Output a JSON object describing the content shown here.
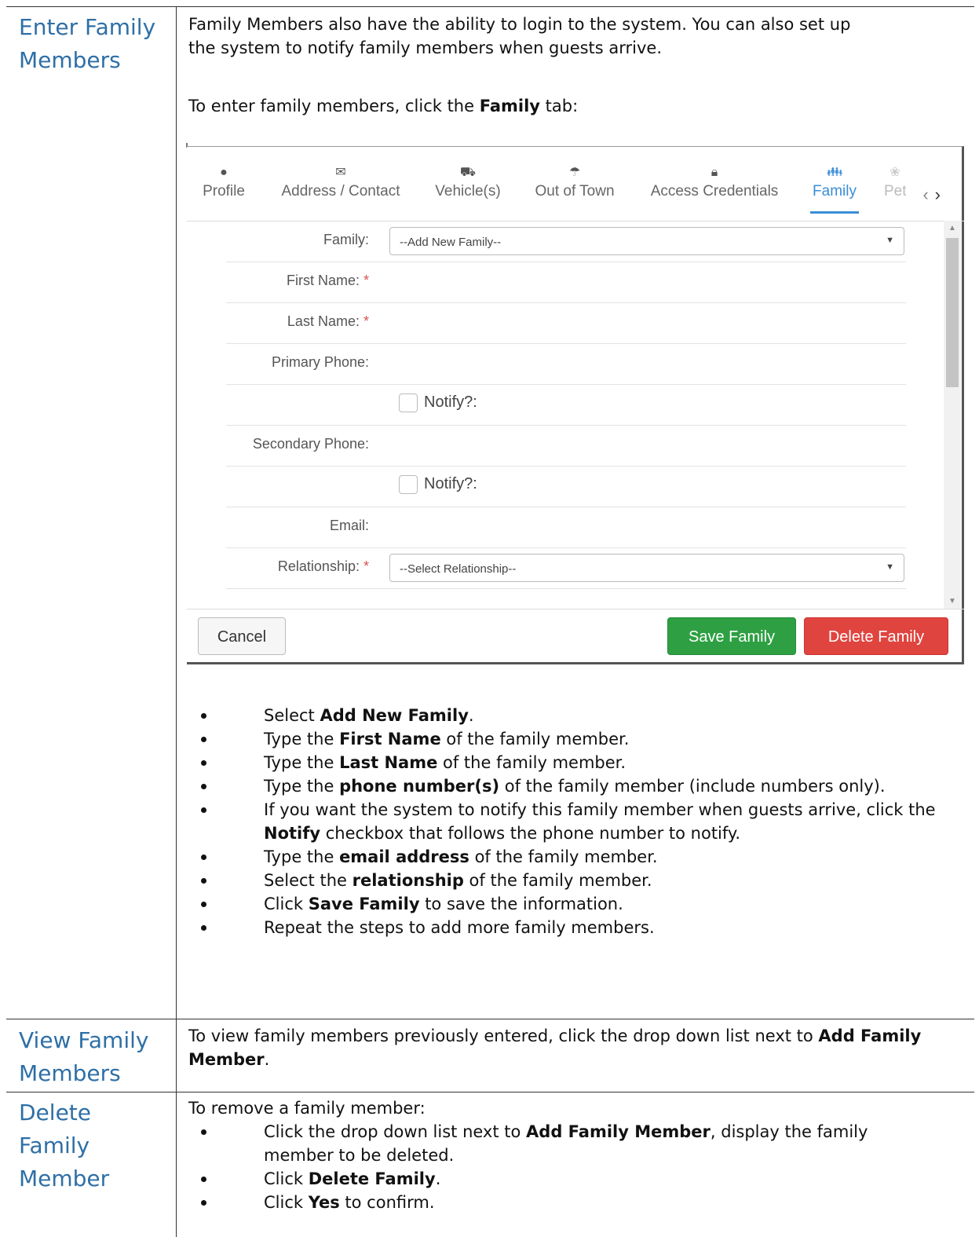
{
  "sections": [
    {
      "topic": [
        "Enter Family",
        "Members"
      ],
      "intro": [
        "Family Members also have the ability to login to the system. You can also set up",
        "the system to notify family members when guests arrive."
      ],
      "instruction": {
        "pre": "To enter family members, click the ",
        "bold": "Family",
        "post": " tab:"
      },
      "steps": [
        {
          "pre": "Select ",
          "bold": "Add New Family",
          "post": "."
        },
        {
          "pre": "Type the ",
          "bold": "First Name",
          "post": " of the family member."
        },
        {
          "pre": "Type the ",
          "bold": "Last Name",
          "post": " of the family member."
        },
        {
          "pre": "Type the ",
          "bold": "phone number(s)",
          "post": " of the family member (include numbers only)."
        },
        {
          "pre": "If you want the system to notify this family member when guests arrive, click the ",
          "bold": "Notify",
          "post": " checkbox that follows the phone number to notify."
        },
        {
          "pre": "Type the ",
          "bold": "email address",
          "post": " of the family member."
        },
        {
          "pre": "Select the ",
          "bold": "relationship",
          "post": " of the family member."
        },
        {
          "pre": "Click ",
          "bold": "Save Family",
          "post": " to save the information."
        },
        {
          "pre": "Repeat the steps to add more family members.",
          "bold": "",
          "post": ""
        }
      ]
    },
    {
      "topic": [
        "View Family",
        "Members"
      ],
      "text": {
        "pre": "To view family members previously entered, click the drop down list next to ",
        "bold": "Add Family Member",
        "post": "."
      }
    },
    {
      "topic": [
        "Delete",
        "Family",
        "Member"
      ],
      "text": "To remove a family member:",
      "steps": [
        {
          "pre": "Click the drop down list next to ",
          "bold": "Add Family Member",
          "post": ", display the family member to be deleted."
        },
        {
          "pre": "Click ",
          "bold": "Delete Family",
          "post": "."
        },
        {
          "pre": "Click ",
          "bold": "Yes",
          "post": " to confirm."
        }
      ]
    }
  ],
  "screenshot": {
    "tabs": [
      {
        "label": "Profile",
        "icon": "user-icon",
        "glyph": "●"
      },
      {
        "label": "Address / Contact",
        "icon": "envelope-icon",
        "glyph": "✉"
      },
      {
        "label": "Vehicle(s)",
        "icon": "car-icon",
        "glyph": "⛟"
      },
      {
        "label": "Out of Town",
        "icon": "umbrella-icon",
        "glyph": "☂"
      },
      {
        "label": "Access Credentials",
        "icon": "lock-icon",
        "glyph": "🔒︎"
      },
      {
        "label": "Family",
        "icon": "family-icon",
        "glyph": "👪︎"
      },
      {
        "label": "Pet",
        "icon": "paw-icon",
        "glyph": "❀"
      }
    ],
    "active_tab": "Family",
    "form": {
      "family_label": "Family:",
      "family_value": "--Add New Family--",
      "first_name_label": "First Name:",
      "last_name_label": "Last Name:",
      "primary_phone_label": "Primary Phone:",
      "notify_label": "Notify?:",
      "secondary_phone_label": "Secondary Phone:",
      "email_label": "Email:",
      "relationship_label": "Relationship:",
      "relationship_value": "--Select Relationship--",
      "required_mark": "*"
    },
    "buttons": {
      "cancel": "Cancel",
      "save": "Save Family",
      "delete": "Delete Family"
    },
    "colors": {
      "active_tab": "#3b8dd6",
      "save": "#2ea043",
      "delete": "#e0443f",
      "topic": "#2e6fa6",
      "required": "#d9534f"
    }
  }
}
